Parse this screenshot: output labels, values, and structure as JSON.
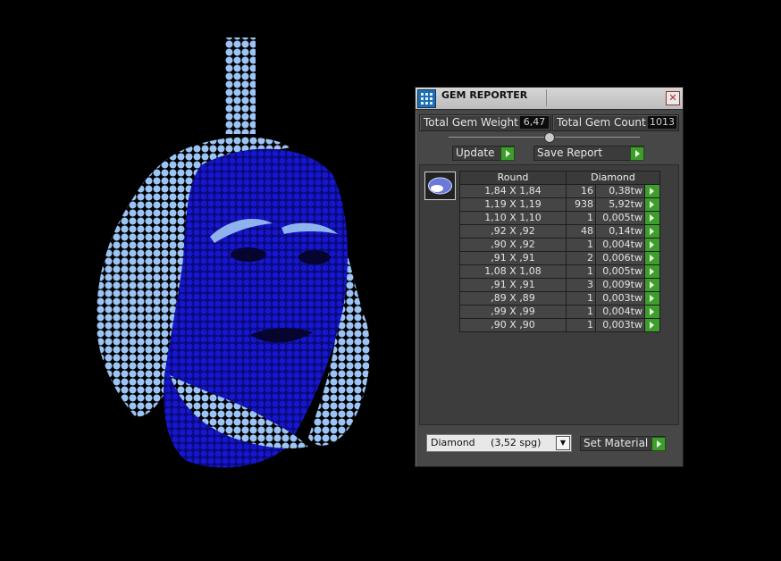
{
  "panel": {
    "title": "GEM REPORTER",
    "close_symbol": "✕",
    "total_weight_label": "Total Gem Weight",
    "total_weight_value": "6,47",
    "total_count_label": "Total Gem Count",
    "total_count_value": "1013",
    "update_label": "Update",
    "save_report_label": "Save Report",
    "table": {
      "headers": [
        "Round",
        "Diamond"
      ],
      "rows": [
        {
          "size": "1,84 X 1,84",
          "count": "16",
          "weight": "0,38tw"
        },
        {
          "size": "1,19 X 1,19",
          "count": "938",
          "weight": "5,92tw"
        },
        {
          "size": "1,10 X 1,10",
          "count": "1",
          "weight": "0,005tw"
        },
        {
          "size": ",92 X ,92",
          "count": "48",
          "weight": "0,14tw"
        },
        {
          "size": ",90 X ,92",
          "count": "1",
          "weight": "0,004tw"
        },
        {
          "size": ",91 X ,91",
          "count": "2",
          "weight": "0,006tw"
        },
        {
          "size": "1,08 X 1,08",
          "count": "1",
          "weight": "0,005tw"
        },
        {
          "size": ",91 X ,91",
          "count": "3",
          "weight": "0,009tw"
        },
        {
          "size": ",89 X ,89",
          "count": "1",
          "weight": "0,003tw"
        },
        {
          "size": ",99 X ,99",
          "count": "1",
          "weight": "0,004tw"
        },
        {
          "size": ",90 X ,90",
          "count": "1",
          "weight": "0,003tw"
        }
      ]
    },
    "material_value": "Diamond     (3,52 spg)",
    "set_material_label": "Set Material"
  },
  "colors": {
    "background": "#000000",
    "face_gems": "#1414c8",
    "outline_gems": "#9cc4f5",
    "go_button": "#3f9d2d",
    "panel_bg": "#474747"
  },
  "icons": [
    "gem-reporter-app-icon",
    "close-icon",
    "go-arrow-icon",
    "round-gem-icon",
    "dropdown-arrow-icon",
    "slider-knob"
  ]
}
